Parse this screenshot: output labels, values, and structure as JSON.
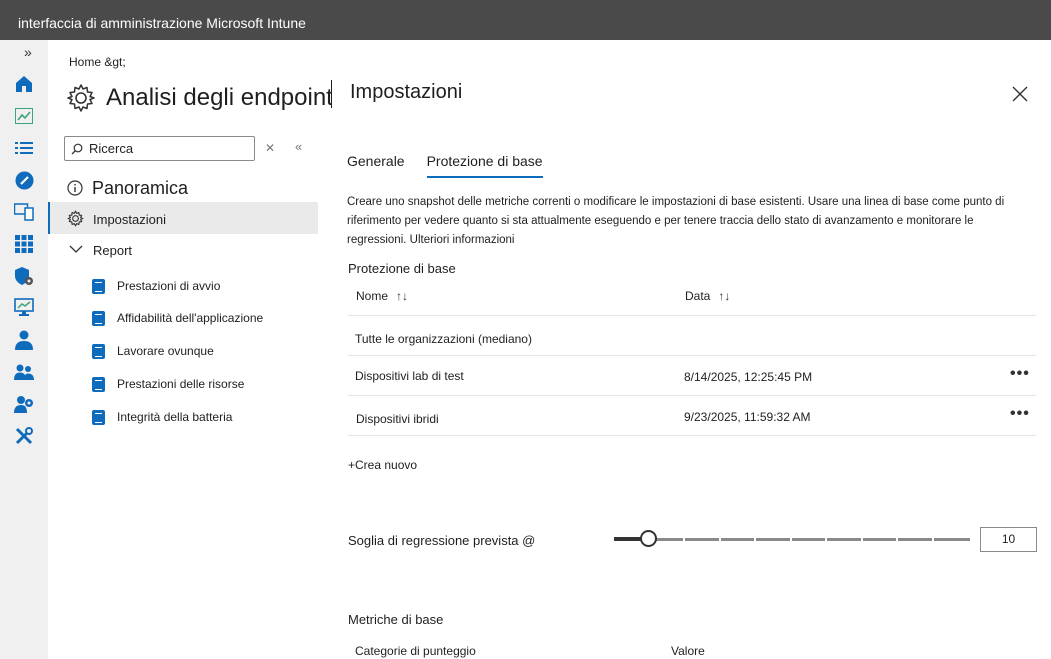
{
  "app": {
    "title": "interfaccia di amministrazione Microsoft Intune"
  },
  "rail": {
    "expand": "»",
    "icons": [
      "home-icon",
      "dashboard-icon",
      "list-icon",
      "devices-icon",
      "apps-device-icon",
      "grid-apps-icon",
      "endpoint-security-icon",
      "reports-monitor-icon",
      "user-icon",
      "groups-icon",
      "tenant-admin-icon",
      "troubleshooting-icon"
    ],
    "colors": {
      "accent": "#0f6cbd",
      "green": "#3aa57a"
    }
  },
  "left": {
    "breadcrumb": "Home &gt;",
    "title": "Analisi degli endpoint",
    "search": {
      "value": "Ricerca"
    },
    "clear": "✕",
    "collapse": "«",
    "overview": "Panoramica",
    "settings": "Impostazioni",
    "reports": "Report",
    "report_items": [
      "Prestazioni di avvio",
      "Affidabilità dell'applicazione",
      "Lavorare ovunque",
      "Prestazioni delle risorse",
      "Integrità della batteria"
    ]
  },
  "panel": {
    "title": "Impostazioni",
    "tabs": [
      "Generale",
      "Protezione di base"
    ],
    "active_tab": "Protezione di base",
    "description": "Creare uno snapshot delle metriche correnti o modificare le impostazioni di base esistenti. Usare una linea di base come punto di riferimento per vedere quanto si sta attualmente eseguendo e per tenere traccia dello stato di avanzamento e monitorare le regressioni.",
    "learn_more": "Ulteriori informazioni",
    "baseline_section": "Protezione di base",
    "columns": {
      "name": "Nome",
      "date": "Data",
      "sort": "↑↓"
    },
    "rows": [
      {
        "name": "Tutte le organizzazioni (mediano)",
        "date": ""
      },
      {
        "name": "Dispositivi lab di test",
        "date": "8/14/2025, 12:25:45 PM",
        "more": "•••"
      },
      {
        "name": "Dispositivi ibridi",
        "date": "9/23/2025, 11:59:32 AM",
        "more": "•••"
      }
    ],
    "create_new": "+Crea nuovo",
    "threshold_label": "Soglia di regressione prevista @",
    "threshold_value": "10",
    "metrics_section": "Metriche di base",
    "metrics_columns": {
      "category": "Categorie di punteggio",
      "value": "Valore"
    }
  }
}
